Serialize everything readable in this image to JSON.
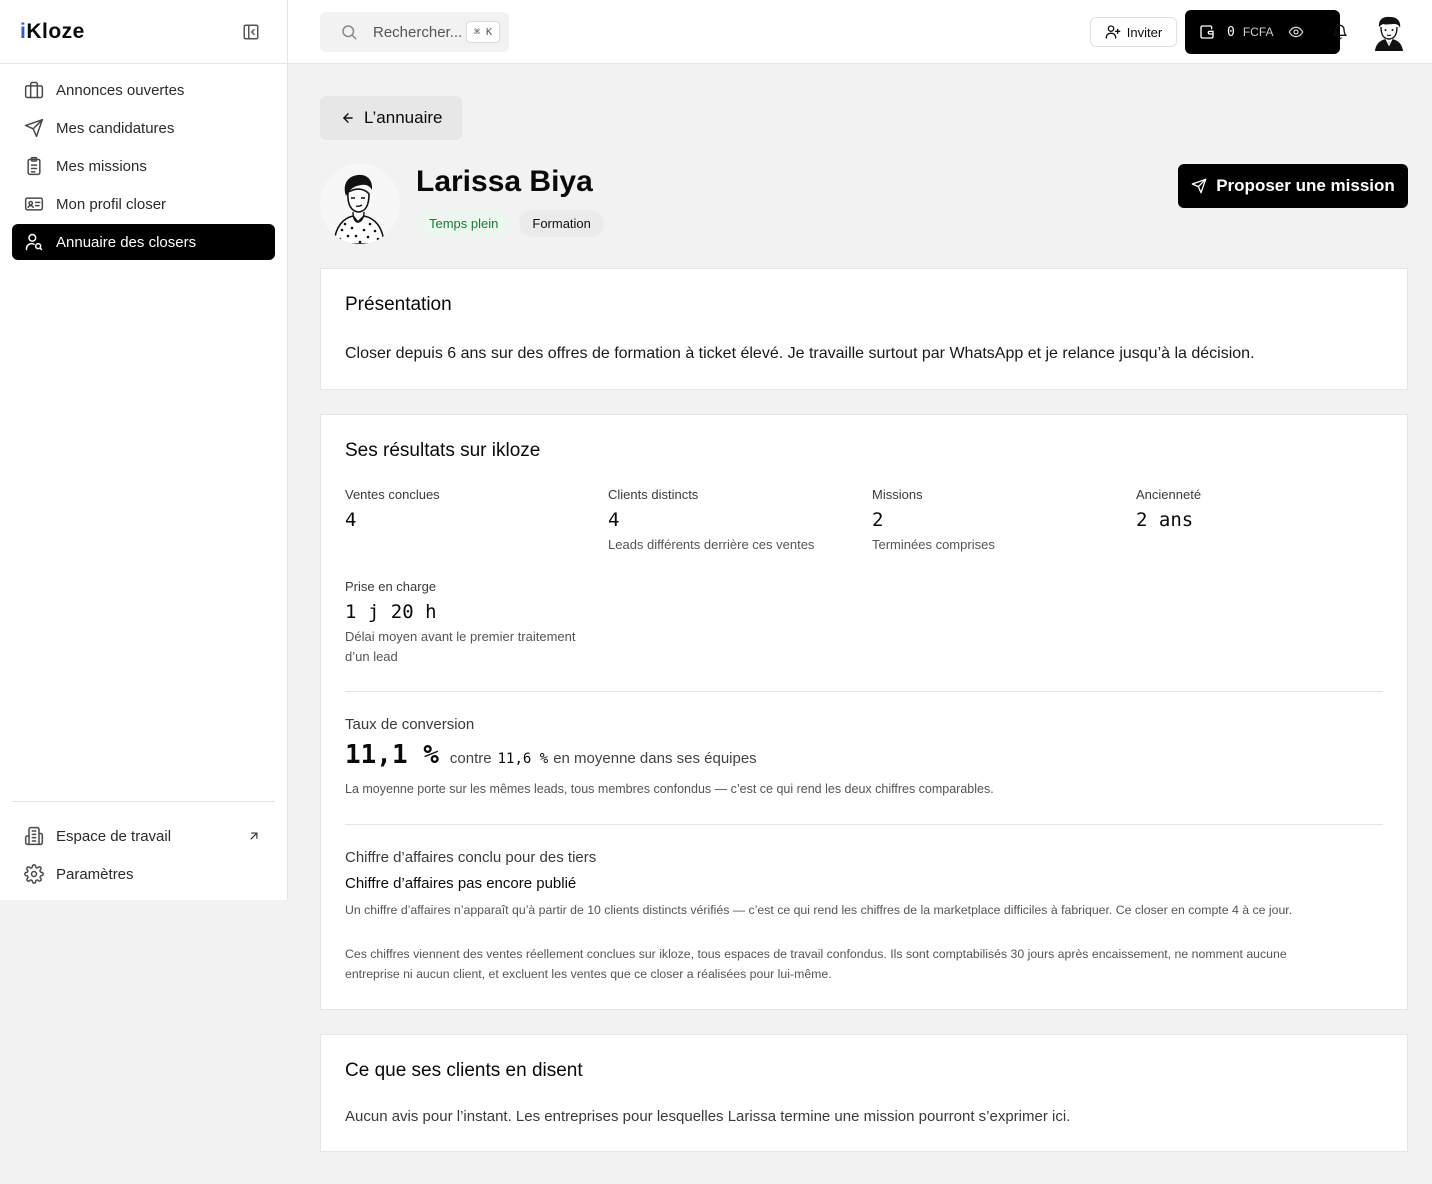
{
  "brand": {
    "name_prefix": "i",
    "name_rest": "Kloze"
  },
  "sidebar": {
    "items": [
      {
        "label": "Annonces ouvertes",
        "icon": "briefcase-icon",
        "active": false
      },
      {
        "label": "Mes candidatures",
        "icon": "send-icon",
        "active": false
      },
      {
        "label": "Mes missions",
        "icon": "clipboard-list-icon",
        "active": false
      },
      {
        "label": "Mon profil closer",
        "icon": "id-card-icon",
        "active": false
      },
      {
        "label": "Annuaire des closers",
        "icon": "user-search-icon",
        "active": true
      }
    ],
    "bottom_items": [
      {
        "label": "Espace de travail",
        "icon": "building-icon",
        "external": true
      },
      {
        "label": "Paramètres",
        "icon": "gear-icon"
      }
    ]
  },
  "topbar": {
    "search_placeholder": "Rechercher...",
    "search_shortcut": "⌘ K",
    "invite_label": "Inviter",
    "wallet_amount": "0",
    "wallet_currency": "FCFA"
  },
  "back_label": "L’annuaire",
  "profile": {
    "name": "Larissa Biya",
    "tags": [
      "Temps plein",
      "Formation"
    ],
    "propose_label": "Proposer une mission"
  },
  "presentation": {
    "title": "Présentation",
    "text": "Closer depuis 6 ans sur des offres de formation à ticket élevé. Je travaille surtout par WhatsApp et je relance jusqu’à la décision."
  },
  "results": {
    "title": "Ses résultats sur ikloze",
    "stats": [
      {
        "label": "Ventes conclues",
        "value": "4",
        "sub": ""
      },
      {
        "label": "Clients distincts",
        "value": "4",
        "sub": "Leads différents derrière ces ventes"
      },
      {
        "label": "Missions",
        "value": "2",
        "sub": "Terminées comprises"
      },
      {
        "label": "Ancienneté",
        "value": "2 ans",
        "sub": ""
      }
    ],
    "prise": {
      "label": "Prise en charge",
      "value": "1 j 20 h",
      "sub_line1": "Délai moyen avant le premier traitement",
      "sub_line2": "d’un lead"
    },
    "conversion": {
      "label": "Taux de conversion",
      "value": "11,1 %",
      "contre": "contre",
      "avg": "11,6 %",
      "avg_suffix": "en moyenne dans ses équipes",
      "note": "La moyenne porte sur les mêmes leads, tous membres confondus — c’est ce qui rend les deux chiffres comparables."
    },
    "revenue": {
      "label": "Chiffre d’affaires conclu pour des tiers",
      "status": "Chiffre d’affaires pas encore publié",
      "note": "Un chiffre d’affaires n’apparaît qu’à partir de 10 clients distincts vérifiés — c’est ce qui rend les chiffres de la marketplace difficiles à fabriquer. Ce closer en compte 4 à ce jour."
    },
    "footnote_line1": "Ces chiffres viennent des ventes réellement conclues sur ikloze, tous espaces de travail confondus. Ils sont comptabilisés 30 jours après encaissement, ne nomment aucune",
    "footnote_line2": "entreprise ni aucun client, et excluent les ventes que ce closer a réalisées pour lui-même."
  },
  "reviews": {
    "title": "Ce que ses clients en disent",
    "empty": "Aucun avis pour l’instant. Les entreprises pour lesquelles Larissa termine une mission pourront s’exprimer ici."
  },
  "colors": {
    "accent": "#000000",
    "brand_i": "#2f5bd8",
    "tag_green_text": "#1a7a35",
    "tag_green_bg": "#eef7ef"
  }
}
